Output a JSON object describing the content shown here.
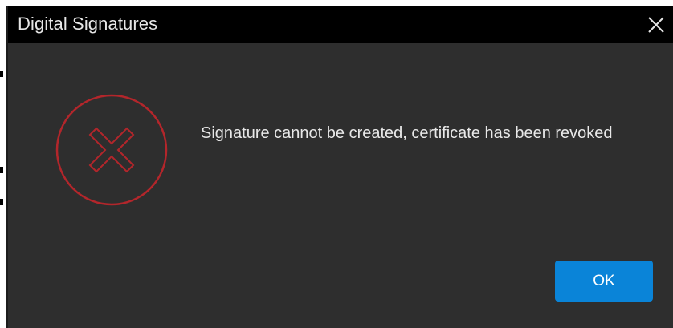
{
  "window": {
    "title": "Digital Signatures",
    "close_icon": "close-icon"
  },
  "dialog": {
    "icon": "error-x-circle-icon",
    "message": "Signature cannot be created, certificate has been revoked",
    "ok_label": "OK"
  },
  "colors": {
    "titlebar": "#000000",
    "background": "#2e2e2e",
    "error_icon": "#b3262b",
    "ok_button": "#0a84d8",
    "text": "#e8e8e8"
  }
}
